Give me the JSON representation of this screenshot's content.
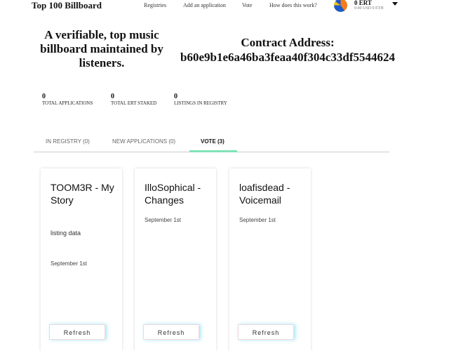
{
  "header": {
    "brand": "Top 100 Billboard",
    "nav": [
      "Registries",
      "Add an application",
      "Vote",
      "How does this work?"
    ],
    "balance": "0 ERT",
    "balance_sub": "0.00 USD 0 ETH"
  },
  "hero": {
    "tagline": "A verifiable, top music billboard maintained by listeners.",
    "contract_label": "Contract Address:",
    "contract_address": "b60e9b1e6a46ba3feaa40f304c33df5544624"
  },
  "stats": [
    {
      "value": "0",
      "label": "TOTAL APPLICATIONS"
    },
    {
      "value": "0",
      "label": "TOTAL ERT STAKED"
    },
    {
      "value": "0",
      "label": "LISTINGS IN REGISTRY"
    }
  ],
  "tabs": [
    {
      "label": "IN REGISTRY (0)"
    },
    {
      "label": "NEW APPLICATIONS (0)"
    },
    {
      "label": "VOTE (3)",
      "active": true
    }
  ],
  "cards": [
    {
      "title": "TOOM3R - My Story",
      "listing": "listing data",
      "date": "September 1st",
      "button": "Refresh"
    },
    {
      "title": "IlloSophical - Changes",
      "date": "September 1st",
      "button": "Refresh"
    },
    {
      "title": "loafisdead - Voicemail",
      "date": "September 1st",
      "button": "Refresh"
    }
  ]
}
